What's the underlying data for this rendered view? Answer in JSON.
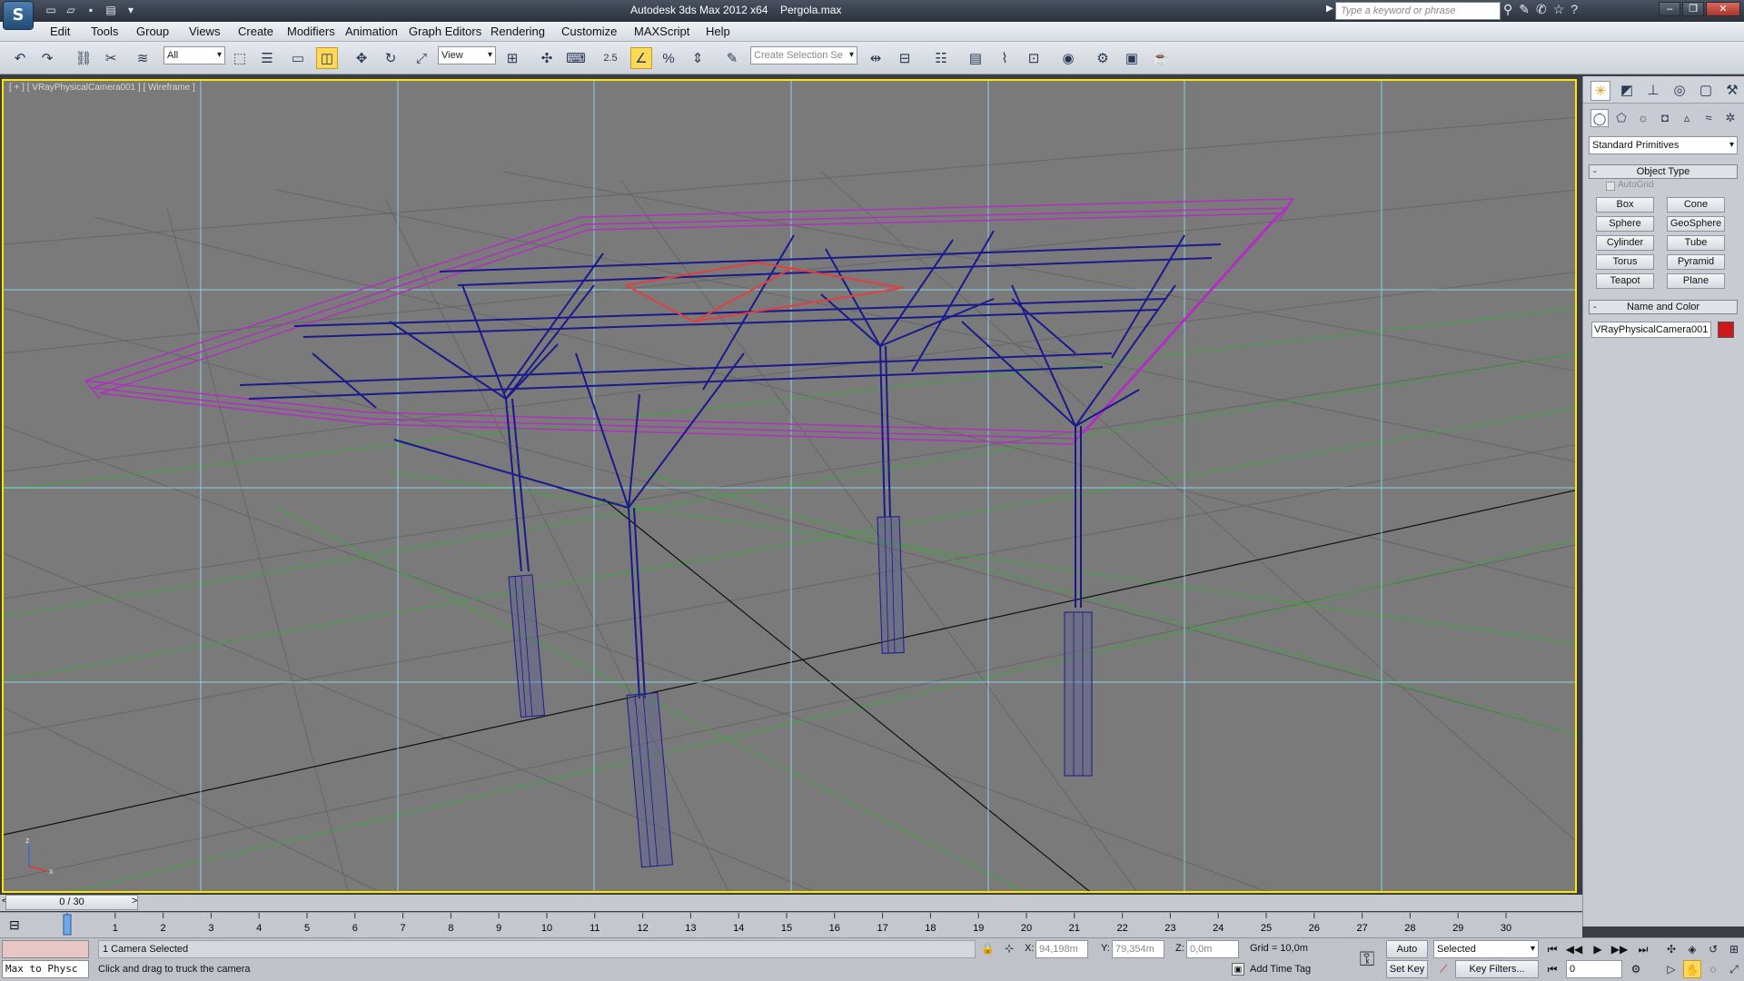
{
  "titlebar": {
    "app_title": "Autodesk 3ds Max  2012 x64",
    "file_name": "Pergola.max",
    "search_placeholder": "Type a keyword or phrase",
    "logo": "S"
  },
  "menubar": {
    "items": [
      "Edit",
      "Tools",
      "Group",
      "Views",
      "Create",
      "Modifiers",
      "Animation",
      "Graph Editors",
      "Rendering",
      "Customize",
      "MAXScript",
      "Help"
    ]
  },
  "toolbar": {
    "selection_filter": "All",
    "ref_coord": "View",
    "snap_label": "2.5",
    "named_selection_placeholder": "Create Selection Se"
  },
  "viewport": {
    "label": "[ + ] [ VRayPhysicalCamera001 ] [ Wireframe ]",
    "axis_x": "x",
    "axis_z": "z"
  },
  "command_panel": {
    "category": "Standard Primitives",
    "object_type_title": "Object Type",
    "autogrid_label": "AutoGrid",
    "primitives": [
      "Box",
      "Cone",
      "Sphere",
      "GeoSphere",
      "Cylinder",
      "Tube",
      "Torus",
      "Pyramid",
      "Teapot",
      "Plane"
    ],
    "name_color_title": "Name and Color",
    "object_name": "VRayPhysicalCamera001",
    "object_color": "#cc1a1a"
  },
  "timeline": {
    "frame_display": "0 / 30",
    "prev_arrow": "<",
    "next_arrow": ">",
    "ticks": [
      "0",
      "1",
      "2",
      "3",
      "4",
      "5",
      "6",
      "7",
      "8",
      "9",
      "10",
      "11",
      "12",
      "13",
      "14",
      "15",
      "16",
      "17",
      "18",
      "19",
      "20",
      "21",
      "22",
      "23",
      "24",
      "25",
      "26",
      "27",
      "28",
      "29",
      "30"
    ]
  },
  "status": {
    "maxscript_text": "Max to Physc",
    "selection_text": "1 Camera Selected",
    "prompt_text": "Click and drag to truck the camera",
    "x_label": "X:",
    "x_value": "94,198m",
    "y_label": "Y:",
    "y_value": "79,354m",
    "z_label": "Z:",
    "z_value": "0,0m",
    "grid_text": "Grid = 10,0m",
    "add_time_tag": "Add Time Tag",
    "auto_key": "Auto Key",
    "set_key": "Set Key",
    "key_mode": "Selected",
    "key_filters": "Key Filters...",
    "current_frame": "0"
  },
  "colors": {
    "viewport_border": "#ffe600",
    "wire_blue": "#1a1a8c",
    "wire_magenta": "#b030c0",
    "wire_red": "#e04040"
  }
}
